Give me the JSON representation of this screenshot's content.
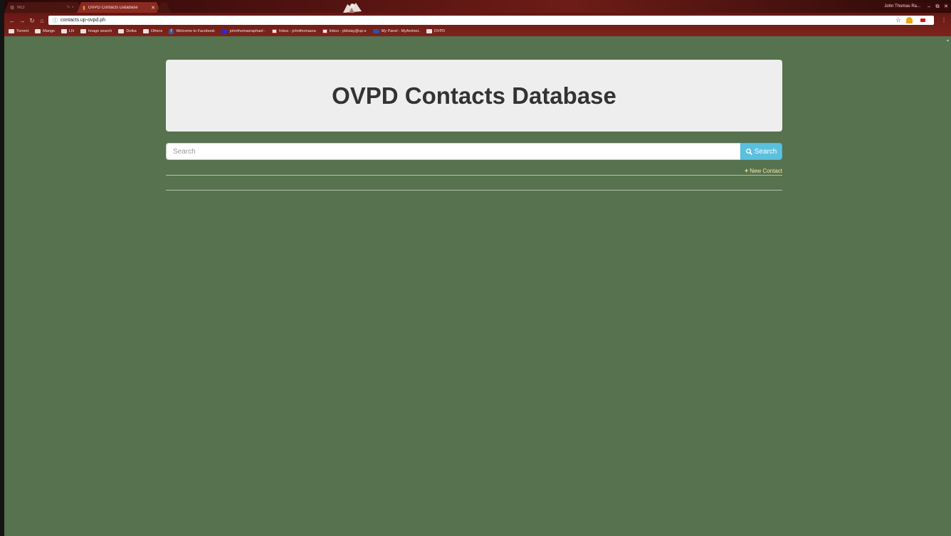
{
  "browser": {
    "tabs": [
      {
        "title": "RCI",
        "extra": "✎ ×",
        "active": false
      },
      {
        "title": "OVPD Contacts Database",
        "active": true
      }
    ],
    "profile_name": "John Thomas Ra...",
    "address": "contacts.up-ovpd.ph",
    "bookmarks": [
      {
        "label": "Torrent",
        "icon": "folder-icon"
      },
      {
        "label": "Mango",
        "icon": "folder-icon"
      },
      {
        "label": "LN",
        "icon": "folder-icon"
      },
      {
        "label": "Image search",
        "icon": "folder-icon"
      },
      {
        "label": "Dotka",
        "icon": "folder-icon"
      },
      {
        "label": "Others",
        "icon": "folder-icon"
      },
      {
        "label": "Welcome to Facebook",
        "icon": "facebook-icon"
      },
      {
        "label": "johnthomasraphael -",
        "icon": "youtube-icon"
      },
      {
        "label": "Inbox - johnthomasra",
        "icon": "gmail-icon"
      },
      {
        "label": "Inbox - jddulay@up.e",
        "icon": "gmail-icon"
      },
      {
        "label": "My Panel - MyAnimeL",
        "icon": "mal-icon"
      },
      {
        "label": "OVPD",
        "icon": "folder-icon"
      }
    ]
  },
  "page": {
    "title": "OVPD Contacts Database",
    "search": {
      "placeholder": "Search",
      "value": "",
      "button_label": "Search"
    },
    "new_contact_label": "New Contact",
    "colors": {
      "background": "#56724e",
      "jumbotron": "#eeeeee",
      "search_button": "#5bc0de",
      "link": "#f5e7a8"
    }
  }
}
